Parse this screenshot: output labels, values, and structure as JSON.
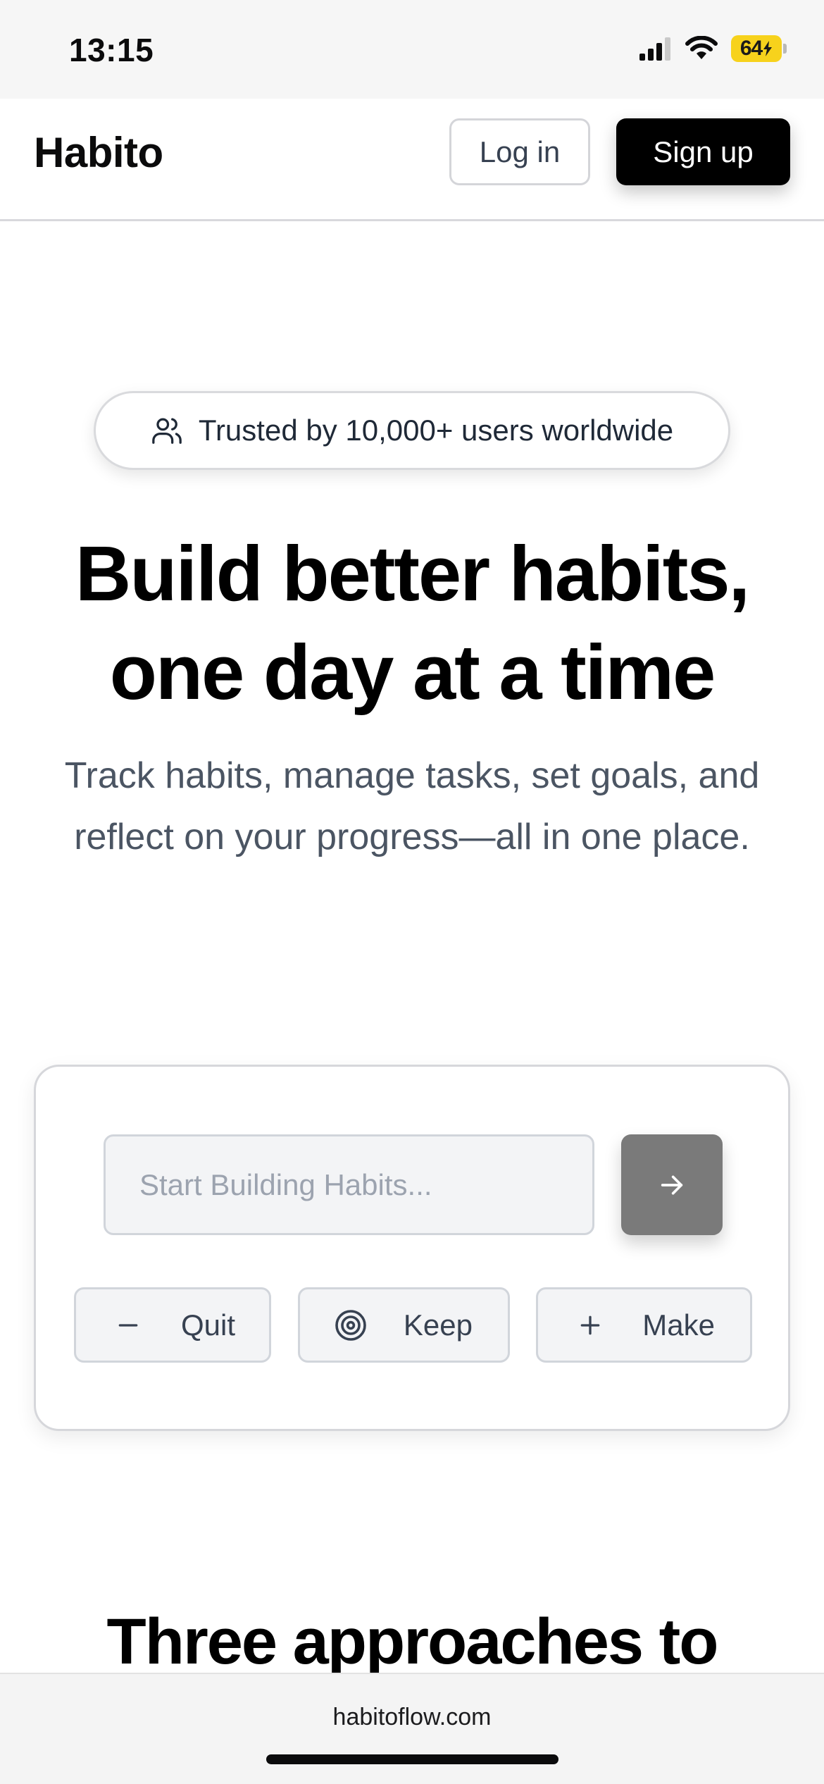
{
  "status_bar": {
    "time": "13:15",
    "battery_level": "64",
    "icons": [
      "cellular-signal-icon",
      "wifi-icon",
      "battery-charging-icon"
    ],
    "battery_color": "#f7d21c"
  },
  "nav": {
    "brand": "Habito",
    "login_label": "Log in",
    "signup_label": "Sign up"
  },
  "hero": {
    "trust_text": "Trusted by 10,000+ users worldwide",
    "trust_icon": "users-icon",
    "title": "Build better habits, one day at a time",
    "subtitle": "Track habits, manage tasks, set goals, and reflect on your progress—all in one place."
  },
  "habit_form": {
    "input_value": "",
    "input_placeholder": "Start Building Habits...",
    "submit_icon": "arrow-right-icon",
    "submit_color": "#7a7a7a",
    "types": [
      {
        "label": "Quit",
        "icon": "minus-icon"
      },
      {
        "label": "Keep",
        "icon": "target-icon"
      },
      {
        "label": "Make",
        "icon": "plus-icon"
      }
    ]
  },
  "section": {
    "heading": "Three approaches to"
  },
  "browser": {
    "url": "habitoflow.com"
  },
  "colors": {
    "primary": "#000000",
    "muted_text": "#4b5563",
    "border": "#d1d5db",
    "input_bg": "#f3f4f6"
  }
}
